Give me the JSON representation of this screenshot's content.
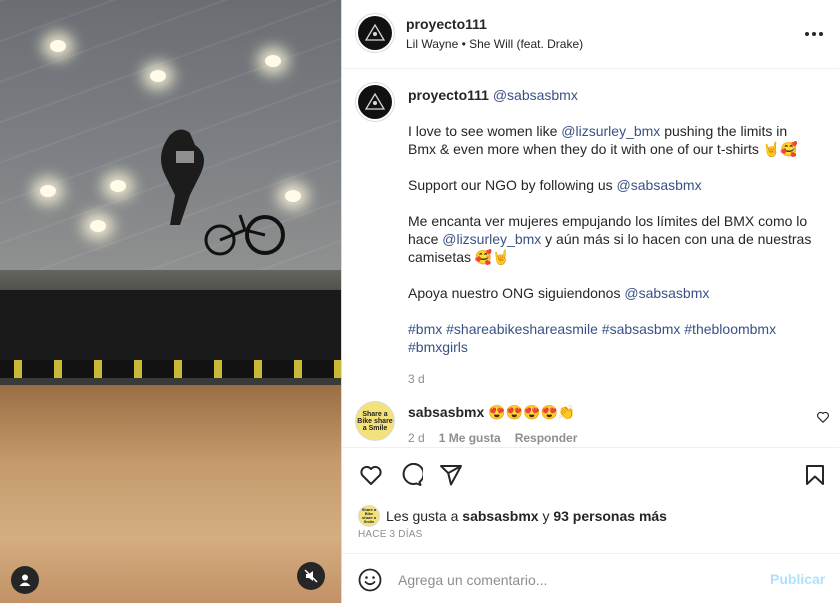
{
  "post": {
    "username": "proyecto111",
    "audio": "Lil Wayne • She Will (feat. Drake)"
  },
  "caption": {
    "username": "proyecto111",
    "mention": "@sabsasbmx",
    "p1_a": "I love to see women like ",
    "p1_link": "@lizsurley_bmx",
    "p1_b": " pushing the limits in Bmx & even more when they do it with one of our t-shirts 🤘🥰",
    "p2_a": "Support our NGO by following us ",
    "p2_link": "@sabsasbmx",
    "p3_a": "Me encanta ver mujeres empujando los límites del BMX como lo hace ",
    "p3_link": "@lizsurley_bmx",
    "p3_b": " y aún más si lo hacen con una de nuestras camisetas 🥰🤘",
    "p4_a": "Apoya nuestro ONG siguiendonos ",
    "p4_link": "@sabsasbmx",
    "hashtags": [
      "#bmx",
      "#shareabikeshareasmile",
      "#sabsasbmx",
      "#thebloombmx",
      "#bmxgirls"
    ],
    "time": "3 d"
  },
  "comment": {
    "username": "sabsasbmx",
    "text": "😍😍😍😍👏",
    "time": "2 d",
    "likes": "1 Me gusta",
    "reply": "Responder",
    "avatar_text": "Share a Bike share a Smile"
  },
  "likes": {
    "prefix": "Les gusta a ",
    "user": "sabsasbmx",
    "mid": " y ",
    "others": "93 personas más"
  },
  "posted": "HACE 3 DÍAS",
  "add_comment": {
    "placeholder": "Agrega un comentario...",
    "publish": "Publicar"
  },
  "icons": {
    "more": "more-icon",
    "like": "heart-icon",
    "comment": "comment-icon",
    "share": "send-icon",
    "save": "bookmark-icon",
    "emoji": "emoji-icon",
    "mute": "muted-speaker-icon",
    "tagged": "person-icon"
  },
  "colors": {
    "link": "#385185",
    "muted": "#8e8e8e",
    "publish_disabled": "#b2dffc"
  }
}
